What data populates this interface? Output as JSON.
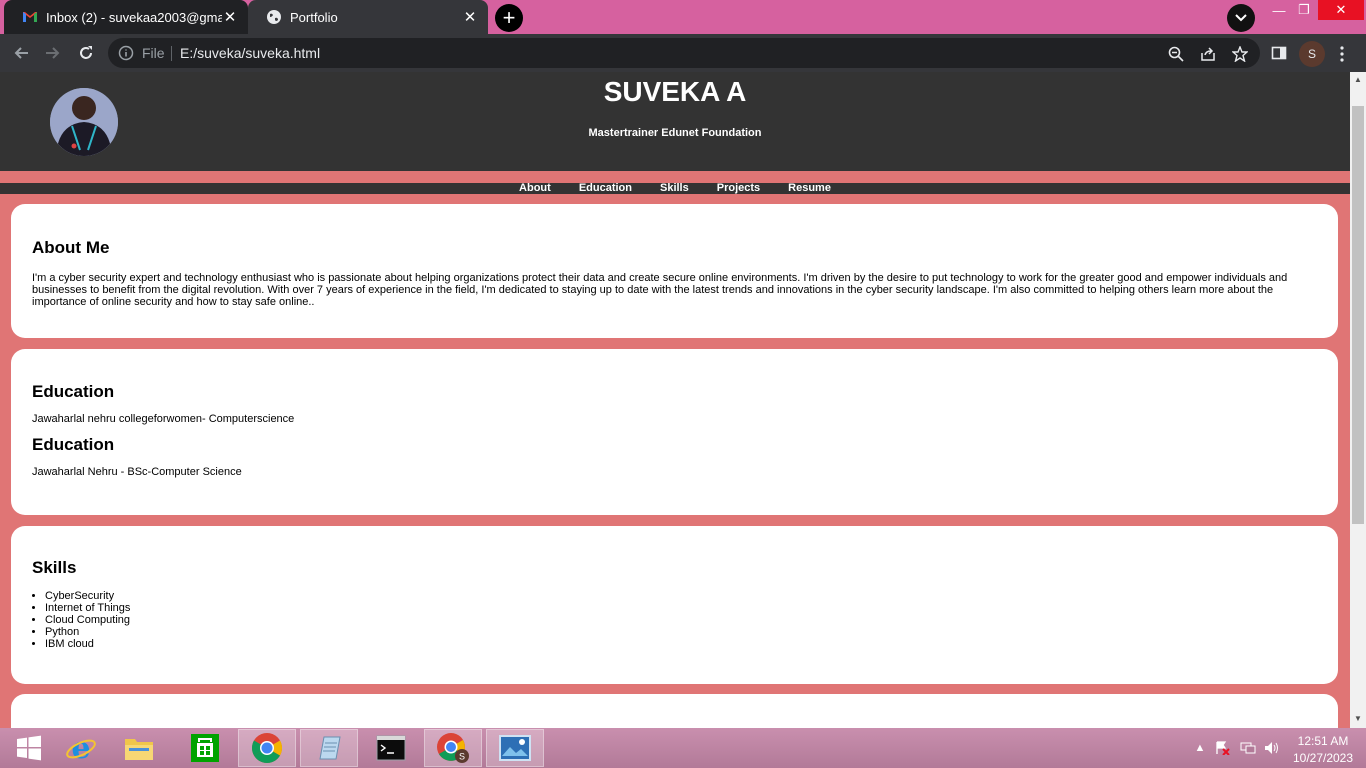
{
  "browser": {
    "tabs": [
      {
        "title": "Inbox (2) - suvekaa2003@gmail.com",
        "active": false
      },
      {
        "title": "Portfolio",
        "active": true
      }
    ],
    "omnibox": {
      "scheme_label": "File",
      "url": "E:/suveka/suveka.html"
    },
    "profile_initial": "S"
  },
  "site": {
    "name": "SUVEKA A",
    "tagline": "Mastertrainer Edunet Foundation",
    "nav": [
      "About",
      "Education",
      "Skills",
      "Projects",
      "Resume"
    ],
    "about": {
      "heading": "About Me",
      "text": "I'm a cyber security expert and technology enthusiast who is passionate about helping organizations protect their data and create secure online environments. I'm driven by the desire to put technology to work for the greater good and empower individuals and businesses to benefit from the digital revolution. With over 7 years of experience in the field, I'm dedicated to staying up to date with the latest trends and innovations in the cyber security landscape. I'm also committed to helping others learn more about the importance of online security and how to stay safe online.."
    },
    "education": [
      {
        "heading": "Education",
        "text": "Jawaharlal nehru collegeforwomen- Computerscience"
      },
      {
        "heading": "Education",
        "text": "Jawaharlal Nehru - BSc-Computer Science"
      }
    ],
    "skills": {
      "heading": "Skills",
      "items": [
        "CyberSecurity",
        "Internet of Things",
        "Cloud Computing",
        "Python",
        "IBM cloud"
      ]
    }
  },
  "taskbar": {
    "apps": [
      "start-icon",
      "internet-explorer-icon",
      "file-explorer-icon",
      "store-icon",
      "chrome-icon",
      "notepad-icon",
      "command-prompt-icon",
      "chrome-profile-icon",
      "photos-icon"
    ],
    "time": "12:51 AM",
    "date": "10/27/2023"
  },
  "colors": {
    "page_bg": "#e07575",
    "header_bg": "#333333",
    "tabstrip": "#d6619f",
    "close": "#e81123"
  }
}
